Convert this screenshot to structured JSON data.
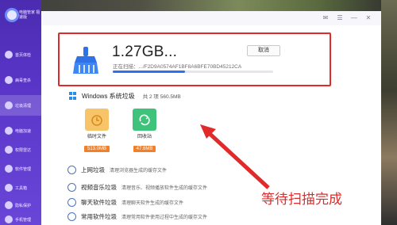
{
  "sidebar": {
    "brand": "电脑管家 极速版",
    "items": [
      {
        "label": "首页体检"
      },
      {
        "label": "病毒查杀"
      },
      {
        "label": "垃圾清理"
      },
      {
        "label": "电脑加速"
      },
      {
        "label": "权限雷达"
      },
      {
        "label": "软件管理"
      },
      {
        "label": "工具箱"
      },
      {
        "label": "隐私保护"
      },
      {
        "label": "手机管理"
      }
    ]
  },
  "titlebar": {
    "buttons": [
      "✉",
      "☰",
      "—",
      "✕"
    ]
  },
  "scan": {
    "size": "1.27GB...",
    "path": "正在扫描：.../F2D9A0574AF1BF8A6BFE70BD45212CA",
    "cancel": "取消",
    "progress": 0.45,
    "colors": {
      "accent": "#2f6ff2",
      "highlight": "#e02b2b"
    }
  },
  "windows_junk": {
    "title": "Windows 系统垃圾",
    "meta": "共 2 项 560.5MB",
    "tiles": [
      {
        "label": "临时文件",
        "size": "513.0MB",
        "color": "#f7c46a",
        "icon": "clock-folder-icon"
      },
      {
        "label": "回收站",
        "size": "47.6MB",
        "color": "#3fc27a",
        "icon": "recycle-bin-icon"
      }
    ]
  },
  "rows": [
    {
      "title": "上网垃圾",
      "desc": "清理浏览器生成的缓存文件",
      "icon": "globe-icon"
    },
    {
      "title": "视频音乐垃圾",
      "desc": "清理音乐、视频播放软件生成的缓存文件",
      "icon": "video-icon"
    },
    {
      "title": "聊天软件垃圾",
      "desc": "清理聊天软件生成的缓存文件",
      "icon": "chat-icon"
    },
    {
      "title": "常用软件垃圾",
      "desc": "清理常用软件使用过程中生成的缓存文件",
      "icon": "app-icon"
    }
  ],
  "annotation": {
    "text": "等待扫描完成"
  }
}
